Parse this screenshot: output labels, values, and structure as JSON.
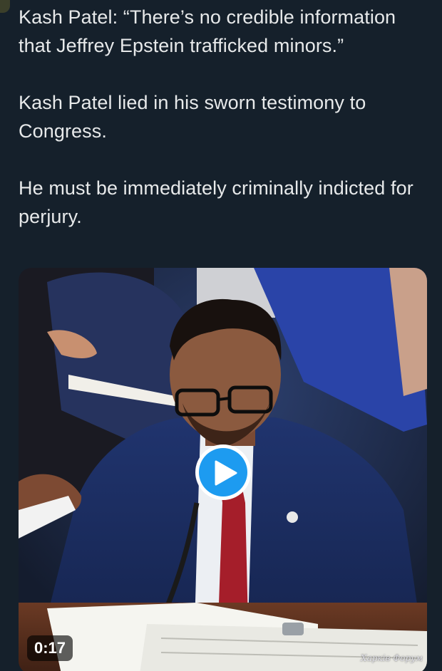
{
  "tweet": {
    "paragraphs": [
      "Kash Patel: “There’s no credible information that Jeffrey Epstein trafficked minors.”",
      "Kash Patel lied in his sworn testimony to Congress.",
      "He must be immediately criminally indicted for perjury."
    ]
  },
  "media": {
    "type": "video",
    "duration": "0:17",
    "watermark": "Харків Форум",
    "play_icon": "play-icon"
  },
  "colors": {
    "background": "#15202b",
    "text": "#e7e9ea",
    "accent": "#1d9bf0"
  }
}
